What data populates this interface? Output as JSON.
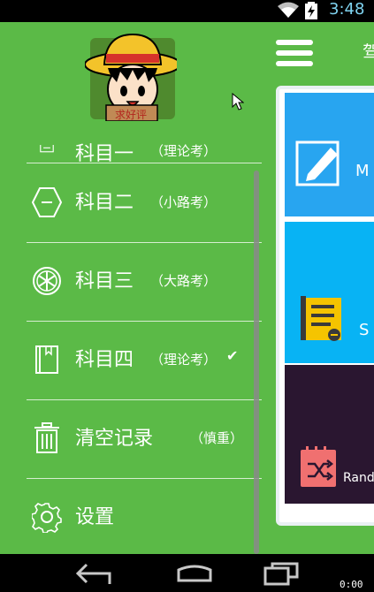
{
  "status_bar": {
    "time": "3:48",
    "icons": [
      "wifi-icon",
      "battery-charging-icon"
    ]
  },
  "header": {
    "title_peek": "驾",
    "menu_icon": "hamburger-icon"
  },
  "drawer": {
    "avatar_text": "求好评",
    "top_partial": {
      "title": "科目一",
      "sub": "（理论考）"
    },
    "items": [
      {
        "icon": "hexagon-minus-icon",
        "title": "科目二",
        "sub": "（小路考）",
        "selected": false
      },
      {
        "icon": "steering-wheel-icon",
        "title": "科目三",
        "sub": "（大路考）",
        "selected": false
      },
      {
        "icon": "book-icon",
        "title": "科目四",
        "sub": "（理论考）",
        "selected": true
      },
      {
        "icon": "trash-icon",
        "title": "清空记录",
        "sub": "（慎重）",
        "selected": false
      },
      {
        "icon": "gear-icon",
        "title": "设置",
        "sub": "",
        "selected": false
      }
    ]
  },
  "cards": [
    {
      "label": "M",
      "icon": "edit-icon",
      "color": "#28a5f0"
    },
    {
      "label": "S",
      "icon": "notepad-icon",
      "color": "#08b3f4"
    },
    {
      "label": "Rand",
      "icon": "shuffle-icon",
      "color": "#2a1630"
    }
  ],
  "nav": [
    "back-icon",
    "home-icon",
    "recents-icon"
  ],
  "overlay": {
    "fps": "0:00"
  },
  "colors": {
    "drawer_bg": "#5bba47",
    "accent_blue": "#28a5f0"
  }
}
